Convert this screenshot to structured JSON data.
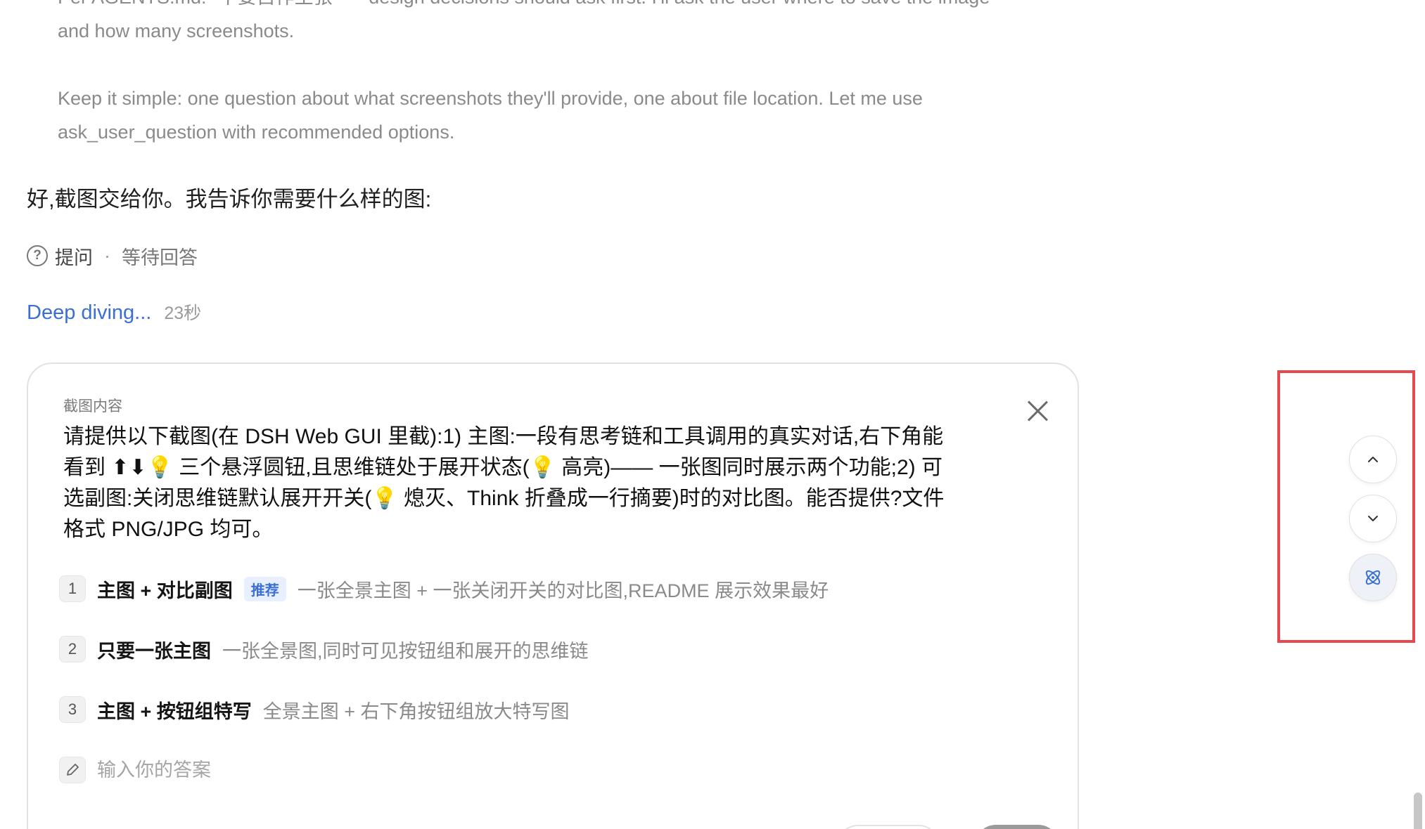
{
  "thinking": {
    "para1_line1": "Per AGENTS.md: \"不要自作主张\" — design decisions should ask first. I'll ask the user where to save the image",
    "para1_line2": "and how many screenshots.",
    "para2_line1": "Keep it simple: one question about what screenshots they'll provide, one about file location. Let me use",
    "para2_line2": "ask_user_question with recommended options."
  },
  "assistant_message": "好,截图交给你。我告诉你需要什么样的图:",
  "status": {
    "icon": "question-circle-icon",
    "label": "提问",
    "separator": "·",
    "state": "等待回答"
  },
  "deep_diving": {
    "label": "Deep diving...",
    "elapsed": "23秒"
  },
  "question_card": {
    "title": "截图内容",
    "close_icon": "close-icon",
    "question_line1": "请提供以下截图(在 DSH Web GUI 里截):1) 主图:一段有思考链和工具调用的真实对话,右下角能",
    "question_line2": "看到 ⬆⬇💡 三个悬浮圆钮,且思维链处于展开状态(💡 高亮)—— 一张图同时展示两个功能;2) 可",
    "question_line3": "选副图:关闭思维链默认展开开关(💡 熄灭、Think 折叠成一行摘要)时的对比图。能否提供?文件",
    "question_line4": "格式 PNG/JPG 均可。",
    "options": [
      {
        "number": "1",
        "title": "主图 + 对比副图",
        "badge": "推荐",
        "description": "一张全景主图 + 一张关闭开关的对比图,README 展示效果最好"
      },
      {
        "number": "2",
        "title": "只要一张主图",
        "description": "一张全景图,同时可见按钮组和展开的思维链"
      },
      {
        "number": "3",
        "title": "主图 + 按钮组特写",
        "description": "全景主图 + 右下角按钮组放大特写图"
      }
    ],
    "answer_placeholder": "输入你的答案",
    "answer_icon": "pencil-icon"
  },
  "floating_buttons": [
    {
      "icon": "chevron-up-icon"
    },
    {
      "icon": "chevron-down-icon"
    },
    {
      "icon": "atom-icon"
    }
  ],
  "colors": {
    "accent_blue": "#3b6fd6",
    "highlight_red": "#e5484d",
    "muted_gray": "#8a8a8a"
  }
}
